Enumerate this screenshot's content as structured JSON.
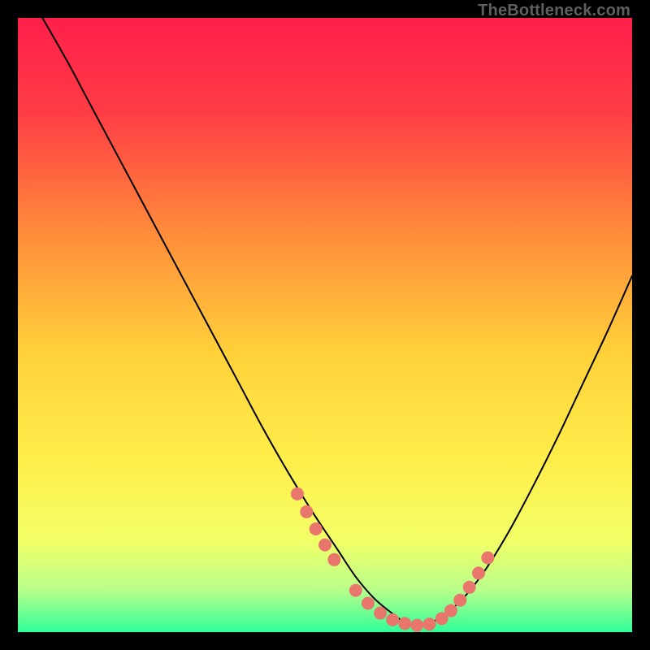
{
  "watermark": "TheBottleneck.com",
  "chart_data": {
    "type": "line",
    "title": "",
    "xlabel": "",
    "ylabel": "",
    "xlim": [
      0,
      100
    ],
    "ylim": [
      0,
      100
    ],
    "grid": false,
    "gradient_stops": [
      {
        "offset": 0.0,
        "color": "#ff1f4b"
      },
      {
        "offset": 0.15,
        "color": "#ff3b45"
      },
      {
        "offset": 0.35,
        "color": "#ff8c3a"
      },
      {
        "offset": 0.55,
        "color": "#ffd23a"
      },
      {
        "offset": 0.72,
        "color": "#ffee4a"
      },
      {
        "offset": 0.85,
        "color": "#f2ff66"
      },
      {
        "offset": 0.93,
        "color": "#baff8a"
      },
      {
        "offset": 1.0,
        "color": "#2fff9a"
      }
    ],
    "series": [
      {
        "name": "bottleneck-curve",
        "color": "#000000",
        "stroke_width": 2,
        "x": [
          4,
          8,
          12,
          16,
          20,
          24,
          28,
          32,
          36,
          40,
          44,
          48,
          52,
          55,
          58,
          61,
          63,
          65,
          68,
          72,
          76,
          80,
          84,
          88,
          92,
          96,
          100
        ],
        "y": [
          100,
          93,
          85.5,
          78,
          70.5,
          63,
          55.5,
          48,
          40.5,
          33,
          26,
          19.5,
          13.5,
          9,
          5.5,
          3,
          1.6,
          1.1,
          1.9,
          5,
          10,
          16.5,
          24,
          32,
          40.5,
          49,
          58
        ]
      }
    ],
    "markers": {
      "name": "highlight-dots",
      "color": "#e9766d",
      "radius": 8,
      "x": [
        45.5,
        47.0,
        48.5,
        50.0,
        51.5,
        55.0,
        57.0,
        59.0,
        61.0,
        63.0,
        65.0,
        67.0,
        69.0,
        70.5,
        72.0,
        73.5,
        75.0,
        76.5
      ],
      "y": [
        22.5,
        19.6,
        16.8,
        14.2,
        11.8,
        6.8,
        4.7,
        3.1,
        2.0,
        1.4,
        1.1,
        1.3,
        2.2,
        3.5,
        5.2,
        7.3,
        9.6,
        12.1
      ]
    }
  }
}
